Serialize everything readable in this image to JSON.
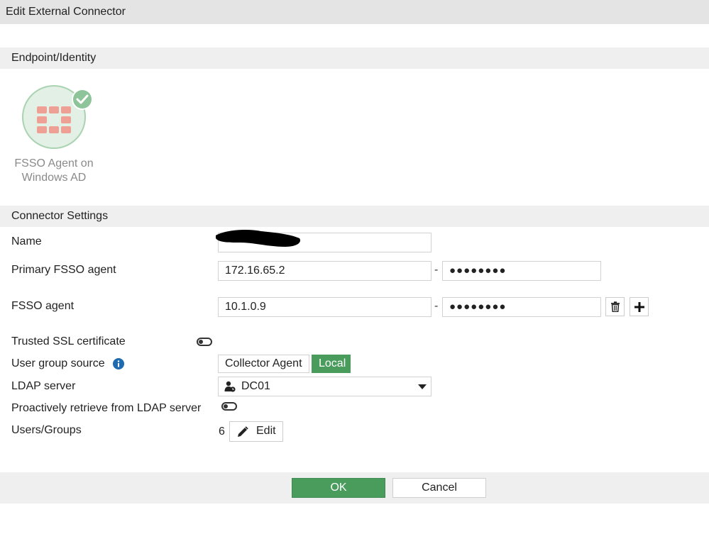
{
  "dialog": {
    "title": "Edit External Connector"
  },
  "sections": {
    "endpoint": "Endpoint/Identity",
    "settings": "Connector Settings"
  },
  "connector_type": {
    "line1": "FSSO Agent on",
    "line2": "Windows AD",
    "icon": "fortinet-logo-icon",
    "status_icon": "checkmark-icon",
    "accent_color": "#5fa36b"
  },
  "fields": {
    "name": {
      "label": "Name",
      "value": ""
    },
    "primary_agent": {
      "label": "Primary FSSO agent",
      "ip": "172.16.65.2",
      "password": "●●●●●●●●",
      "separator": "-"
    },
    "agent": {
      "label": "FSSO agent",
      "ip": "10.1.0.9",
      "password": "●●●●●●●●",
      "separator": "-"
    },
    "trusted_ssl": {
      "label": "Trusted SSL certificate",
      "enabled": false
    },
    "user_group_source": {
      "label": "User group source",
      "options": [
        "Collector Agent",
        "Local"
      ],
      "selected": "Local"
    },
    "ldap_server": {
      "label": "LDAP server",
      "value": "DC01"
    },
    "proactive": {
      "label": "Proactively retrieve from LDAP server",
      "enabled": false
    },
    "users_groups": {
      "label": "Users/Groups",
      "count": "6",
      "edit_label": "Edit"
    }
  },
  "footer": {
    "ok_label": "OK",
    "cancel_label": "Cancel"
  },
  "colors": {
    "primary_green": "#4a9c5d",
    "header_gray": "#e4e4e4",
    "section_gray": "#efefef"
  }
}
